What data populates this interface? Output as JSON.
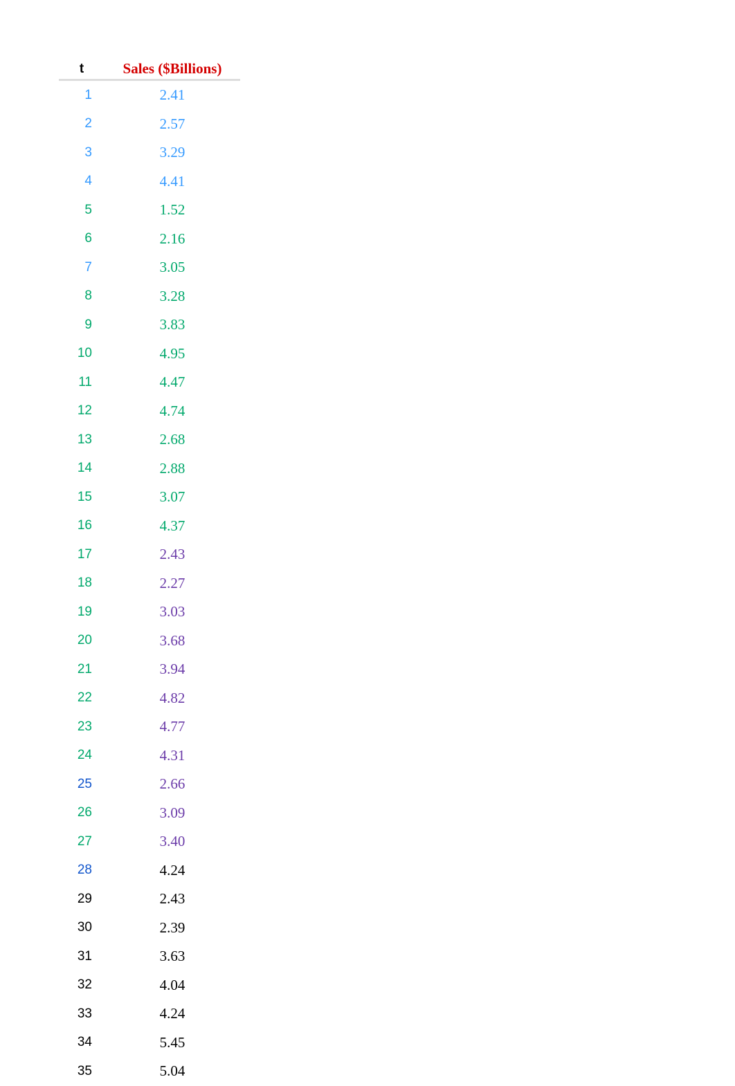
{
  "table": {
    "headers": {
      "t": "t",
      "sales": "Sales ($Billions)"
    },
    "rows": [
      {
        "t": "1",
        "sales": "2.41",
        "tColor": "color-blue",
        "sColor": "color-blue"
      },
      {
        "t": "2",
        "sales": "2.57",
        "tColor": "color-blue",
        "sColor": "color-blue"
      },
      {
        "t": "3",
        "sales": "3.29",
        "tColor": "color-blue",
        "sColor": "color-blue"
      },
      {
        "t": "4",
        "sales": "4.41",
        "tColor": "color-blue",
        "sColor": "color-blue"
      },
      {
        "t": "5",
        "sales": "1.52",
        "tColor": "color-green",
        "sColor": "color-green"
      },
      {
        "t": "6",
        "sales": "2.16",
        "tColor": "color-green",
        "sColor": "color-green"
      },
      {
        "t": "7",
        "sales": "3.05",
        "tColor": "color-blue",
        "sColor": "color-green"
      },
      {
        "t": "8",
        "sales": "3.28",
        "tColor": "color-green",
        "sColor": "color-green"
      },
      {
        "t": "9",
        "sales": "3.83",
        "tColor": "color-green",
        "sColor": "color-green"
      },
      {
        "t": "10",
        "sales": "4.95",
        "tColor": "color-green",
        "sColor": "color-green"
      },
      {
        "t": "11",
        "sales": "4.47",
        "tColor": "color-green",
        "sColor": "color-green"
      },
      {
        "t": "12",
        "sales": "4.74",
        "tColor": "color-green",
        "sColor": "color-green"
      },
      {
        "t": "13",
        "sales": "2.68",
        "tColor": "color-green",
        "sColor": "color-green"
      },
      {
        "t": "14",
        "sales": "2.88",
        "tColor": "color-green",
        "sColor": "color-green"
      },
      {
        "t": "15",
        "sales": "3.07",
        "tColor": "color-green",
        "sColor": "color-green"
      },
      {
        "t": "16",
        "sales": "4.37",
        "tColor": "color-green",
        "sColor": "color-green"
      },
      {
        "t": "17",
        "sales": "2.43",
        "tColor": "color-green",
        "sColor": "color-purple"
      },
      {
        "t": "18",
        "sales": "2.27",
        "tColor": "color-green",
        "sColor": "color-purple"
      },
      {
        "t": "19",
        "sales": "3.03",
        "tColor": "color-green",
        "sColor": "color-purple"
      },
      {
        "t": "20",
        "sales": "3.68",
        "tColor": "color-green",
        "sColor": "color-purple"
      },
      {
        "t": "21",
        "sales": "3.94",
        "tColor": "color-green",
        "sColor": "color-purple"
      },
      {
        "t": "22",
        "sales": "4.82",
        "tColor": "color-green",
        "sColor": "color-purple"
      },
      {
        "t": "23",
        "sales": "4.77",
        "tColor": "color-green",
        "sColor": "color-purple"
      },
      {
        "t": "24",
        "sales": "4.31",
        "tColor": "color-green",
        "sColor": "color-purple"
      },
      {
        "t": "25",
        "sales": "2.66",
        "tColor": "color-darkblue",
        "sColor": "color-purple"
      },
      {
        "t": "26",
        "sales": "3.09",
        "tColor": "color-green",
        "sColor": "color-purple"
      },
      {
        "t": "27",
        "sales": "3.40",
        "tColor": "color-green",
        "sColor": "color-purple"
      },
      {
        "t": "28",
        "sales": "4.24",
        "tColor": "color-darkblue",
        "sColor": "color-black"
      },
      {
        "t": "29",
        "sales": "2.43",
        "tColor": "color-black",
        "sColor": "color-black"
      },
      {
        "t": "30",
        "sales": "2.39",
        "tColor": "color-black",
        "sColor": "color-black"
      },
      {
        "t": "31",
        "sales": "3.63",
        "tColor": "color-black",
        "sColor": "color-black"
      },
      {
        "t": "32",
        "sales": "4.04",
        "tColor": "color-black",
        "sColor": "color-black"
      },
      {
        "t": "33",
        "sales": "4.24",
        "tColor": "color-black",
        "sColor": "color-black"
      },
      {
        "t": "34",
        "sales": "5.45",
        "tColor": "color-black",
        "sColor": "color-black"
      },
      {
        "t": "35",
        "sales": "5.04",
        "tColor": "color-black",
        "sColor": "color-black"
      }
    ]
  },
  "chart_data": {
    "type": "table",
    "title": "Sales ($Billions)",
    "xlabel": "t",
    "ylabel": "Sales ($Billions)",
    "x": [
      1,
      2,
      3,
      4,
      5,
      6,
      7,
      8,
      9,
      10,
      11,
      12,
      13,
      14,
      15,
      16,
      17,
      18,
      19,
      20,
      21,
      22,
      23,
      24,
      25,
      26,
      27,
      28,
      29,
      30,
      31,
      32,
      33,
      34,
      35
    ],
    "values": [
      2.41,
      2.57,
      3.29,
      4.41,
      1.52,
      2.16,
      3.05,
      3.28,
      3.83,
      4.95,
      4.47,
      4.74,
      2.68,
      2.88,
      3.07,
      4.37,
      2.43,
      2.27,
      3.03,
      3.68,
      3.94,
      4.82,
      4.77,
      4.31,
      2.66,
      3.09,
      3.4,
      4.24,
      2.43,
      2.39,
      3.63,
      4.04,
      4.24,
      5.45,
      5.04
    ]
  }
}
